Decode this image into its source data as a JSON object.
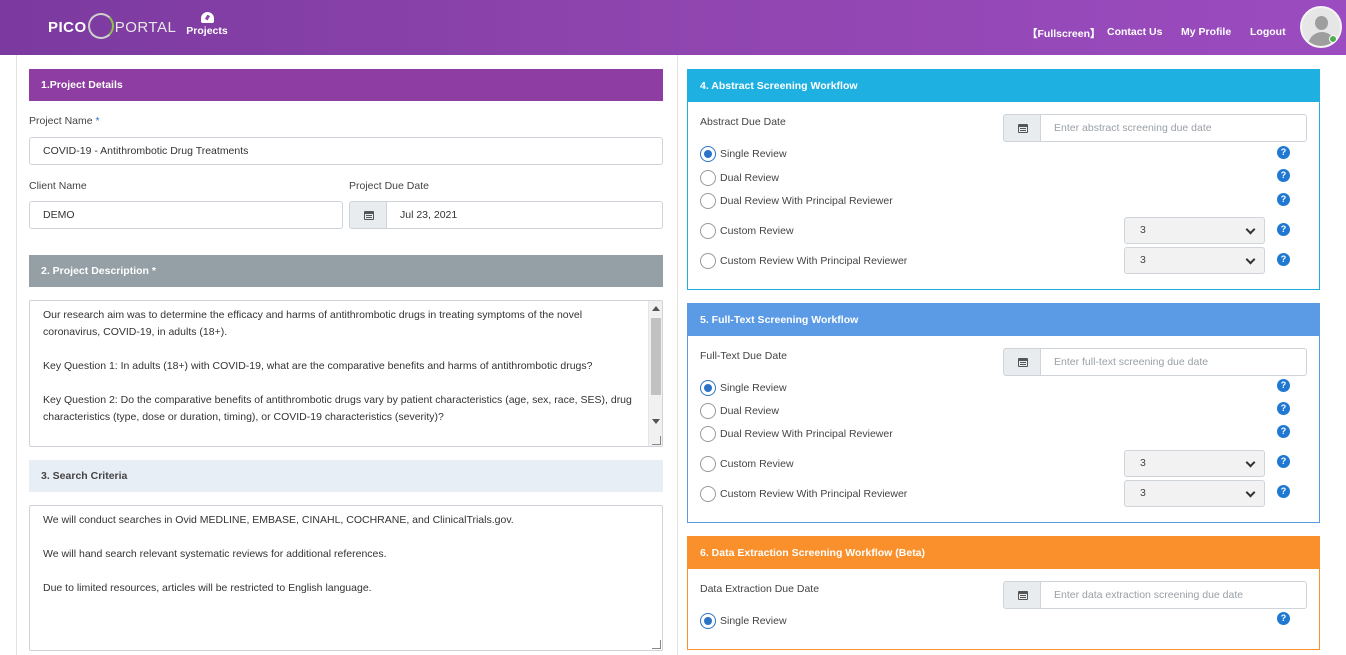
{
  "header": {
    "logo_left": "PICO",
    "logo_right": "PORTAL",
    "projects_label": "Projects",
    "fullscreen_label": "【Fullscreen】",
    "contact_label": "Contact Us",
    "profile_label": "My Profile",
    "logout_label": "Logout"
  },
  "project_details": {
    "title": "1.Project Details",
    "name_label": "Project Name",
    "required_mark": "*",
    "name_value": "COVID-19 - Antithrombotic Drug Treatments",
    "client_label": "Client Name",
    "client_value": "DEMO",
    "due_label": "Project Due Date",
    "due_value": "Jul 23, 2021"
  },
  "description": {
    "title": "2. Project Description *",
    "lines": [
      "Our research aim was to determine the efficacy and harms of antithrombotic drugs in treating symptoms of the novel coronavirus, COVID-19, in adults (18+).",
      "Key Question 1: In adults (18+) with COVID-19, what are the comparative benefits and harms of antithrombotic drugs?",
      "Key Question 2: Do the comparative benefits of antithrombotic drugs vary by patient characteristics (age, sex, race, SES), drug characteristics (type, dose or duration, timing), or COVID-19 characteristics (severity)?"
    ]
  },
  "search": {
    "title": "3. Search Criteria",
    "lines": [
      "We will conduct searches in Ovid MEDLINE, EMBASE, CINAHL, COCHRANE, and ClinicalTrials.gov.",
      "We will hand search relevant systematic reviews for additional references.",
      "Due to limited resources, articles will be restricted to English language."
    ]
  },
  "abstract": {
    "title": "4. Abstract Screening Workflow",
    "due_label": "Abstract Due Date",
    "due_placeholder": "Enter abstract screening due date",
    "options": [
      "Single Review",
      "Dual Review",
      "Dual Review With Principal Reviewer",
      "Custom Review",
      "Custom Review With Principal Reviewer"
    ],
    "selected": "Single Review",
    "custom_value": "3",
    "custom_principal_value": "3"
  },
  "fulltext": {
    "title": "5. Full-Text Screening Workflow",
    "due_label": "Full-Text Due Date",
    "due_placeholder": "Enter full-text screening due date",
    "options": [
      "Single Review",
      "Dual Review",
      "Dual Review With Principal Reviewer",
      "Custom Review",
      "Custom Review With Principal Reviewer"
    ],
    "selected": "Single Review",
    "custom_value": "3",
    "custom_principal_value": "3"
  },
  "extraction": {
    "title": "6. Data Extraction Screening Workflow (Beta)",
    "due_label": "Data Extraction Due Date",
    "due_placeholder": "Enter data extraction screening due date",
    "options": [
      "Single Review"
    ],
    "selected": "Single Review"
  },
  "help_glyph": "?",
  "icons": {
    "projects": "dashboard-icon",
    "calendar": "calendar-icon",
    "help": "question-circle-icon",
    "chevron": "chevron-down-icon",
    "avatar": "user-avatar-icon"
  },
  "colors": {
    "header": "#8e44ad",
    "project_details": "#8e3da3",
    "description": "#95a0a6",
    "search": "#e8eef5",
    "abstract": "#1fb0e2",
    "fulltext": "#5b9be6",
    "extraction": "#f9902b",
    "radio_checked": "#2b73c6",
    "help": "#1f78d1"
  }
}
